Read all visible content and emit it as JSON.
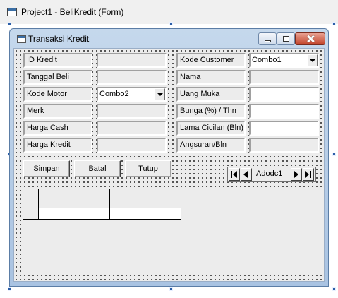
{
  "ide": {
    "title": "Project1 - BeliKredit (Form)"
  },
  "form": {
    "title": "Transaksi Kredit"
  },
  "left_fields": [
    {
      "label": "ID Kredit"
    },
    {
      "label": "Tanggal Beli"
    },
    {
      "label": "Kode Motor",
      "combo": "Combo2"
    },
    {
      "label": "Merk"
    },
    {
      "label": "Harga Cash"
    },
    {
      "label": "Harga Kredit"
    }
  ],
  "right_fields": [
    {
      "label": "Kode Customer",
      "combo": "Combo1"
    },
    {
      "label": "Nama"
    },
    {
      "label": "Uang Muka"
    },
    {
      "label": "Bunga (%) / Thn"
    },
    {
      "label": "Lama Cicilan (Bln)"
    },
    {
      "label": "Angsuran/Bln"
    }
  ],
  "buttons": {
    "simpan": {
      "hotkey": "S",
      "rest": "impan"
    },
    "batal": {
      "hotkey": "B",
      "rest": "atal"
    },
    "tutup": {
      "hotkey": "T",
      "rest": "utup"
    }
  },
  "adodc": {
    "caption": "Adodc1"
  },
  "icons": [
    "form-icon",
    "minimize-icon",
    "maximize-icon",
    "close-icon",
    "first-record-icon",
    "previous-record-icon",
    "next-record-icon",
    "last-record-icon",
    "dropdown-arrow-icon"
  ],
  "colors": {
    "form_face": "#ececec",
    "title_gradient_top": "#c5d8ec",
    "close_button": "#c2432a"
  }
}
